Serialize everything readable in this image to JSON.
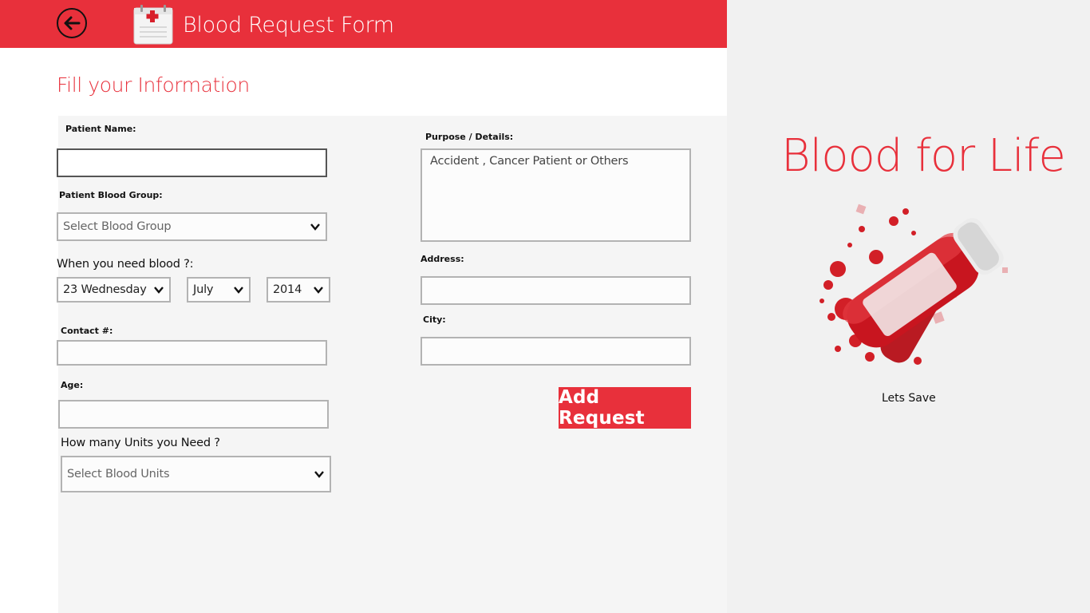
{
  "header": {
    "title": "Blood Request Form"
  },
  "section_title": "Fill your Information",
  "form": {
    "patient_name": {
      "label": "Patient Name:",
      "value": ""
    },
    "blood_group": {
      "label": "Patient Blood Group:",
      "placeholder": "Select Blood Group"
    },
    "need_date": {
      "label": "When you need blood ?:",
      "day": "23 Wednesday",
      "month": "July",
      "year": "2014"
    },
    "contact": {
      "label": "Contact #:",
      "value": ""
    },
    "age": {
      "label": "Age:",
      "value": ""
    },
    "units": {
      "label": "How many Units you Need ?",
      "placeholder": "Select Blood Units"
    },
    "purpose": {
      "label": "Purpose / Details:",
      "placeholder": "Accident , Cancer Patient or Others"
    },
    "address": {
      "label": "Address:",
      "value": ""
    },
    "city": {
      "label": "City:",
      "value": ""
    },
    "submit_label": "Add Request"
  },
  "sidebar": {
    "title": "Blood for Life",
    "tagline": "Lets Save"
  },
  "colors": {
    "accent": "#e8303b",
    "panel": "#f5f5f5",
    "side": "#f1f1f1"
  },
  "icons": {
    "back": "back-arrow-icon",
    "form": "clipboard-icon",
    "chevron": "chevron-down-icon"
  }
}
